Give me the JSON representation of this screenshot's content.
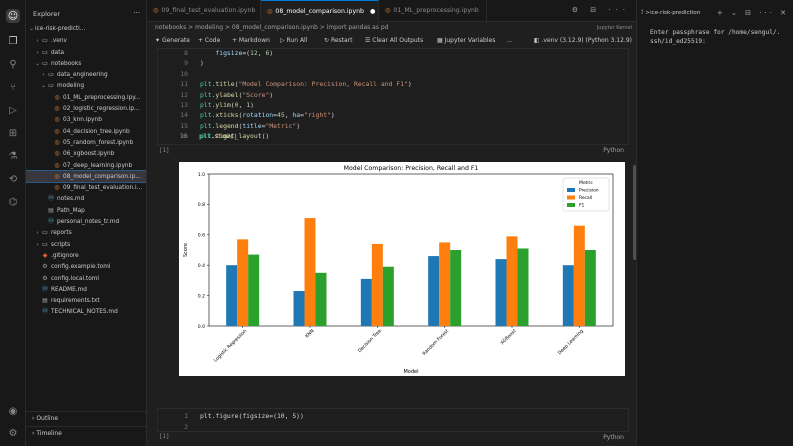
{
  "explorer": {
    "title": "Explorer",
    "root": "ice-risk-predicti...",
    "items": [
      {
        "label": ".venv",
        "type": "folder",
        "depth": 1,
        "collapsed": true
      },
      {
        "label": "data",
        "type": "folder",
        "depth": 1,
        "collapsed": true
      },
      {
        "label": "notebooks",
        "type": "folder",
        "depth": 1,
        "collapsed": false
      },
      {
        "label": "data_engineering",
        "type": "folder",
        "depth": 2,
        "collapsed": true
      },
      {
        "label": "modeling",
        "type": "folder",
        "depth": 2,
        "collapsed": false
      },
      {
        "label": "01_ML_preprocessing.ipy...",
        "type": "notebook",
        "depth": 3
      },
      {
        "label": "02_logistic_regression.ip...",
        "type": "notebook",
        "depth": 3
      },
      {
        "label": "03_knn.ipynb",
        "type": "notebook",
        "depth": 3
      },
      {
        "label": "04_decision_tree.ipynb",
        "type": "notebook",
        "depth": 3
      },
      {
        "label": "05_random_forest.ipynb",
        "type": "notebook",
        "depth": 3
      },
      {
        "label": "06_xgboost.ipynb",
        "type": "notebook",
        "depth": 3
      },
      {
        "label": "07_deep_learning.ipynb",
        "type": "notebook",
        "depth": 3
      },
      {
        "label": "08_model_comparison.ip...",
        "type": "notebook",
        "depth": 3,
        "selected": true
      },
      {
        "label": "09_final_test_evaluation.i...",
        "type": "notebook",
        "depth": 3
      },
      {
        "label": "notes.md",
        "type": "md",
        "depth": 2
      },
      {
        "label": "Path_Map",
        "type": "file",
        "depth": 2
      },
      {
        "label": "personal_notes_tr.md",
        "type": "md",
        "depth": 2
      },
      {
        "label": "reports",
        "type": "folder",
        "depth": 1,
        "collapsed": true
      },
      {
        "label": "scripts",
        "type": "folder",
        "depth": 1,
        "collapsed": true
      },
      {
        "label": ".gitignore",
        "type": "git",
        "depth": 1
      },
      {
        "label": "config.example.toml",
        "type": "toml",
        "depth": 1
      },
      {
        "label": "config.local.toml",
        "type": "toml",
        "depth": 1
      },
      {
        "label": "README.md",
        "type": "md",
        "depth": 1
      },
      {
        "label": "requirements.txt",
        "type": "file",
        "depth": 1
      },
      {
        "label": "TECHNICAL_NOTES.md",
        "type": "md",
        "depth": 1
      }
    ],
    "outline": "Outline",
    "timeline": "Timeline"
  },
  "tabs": [
    {
      "label": "09_final_test_evaluation.ipynb",
      "active": false
    },
    {
      "label": "08_model_comparison.ipynb",
      "active": true
    },
    {
      "label": "01_ML_preprocessing.ipynb",
      "active": false
    }
  ],
  "breadcrumb": "notebooks > modeling > 08_model_comparison.ipynb > import pandas as pd",
  "toolbar": {
    "generate": "Generate",
    "code": "+ Code",
    "markdown": "+ Markdown",
    "run_all": "Run All",
    "restart": "Restart",
    "clear": "Clear All Outputs",
    "variables": "Jupyter Variables",
    "more": "...",
    "kernel": ".venv (3.12.9) (Python 3.12.9)",
    "kernel_tooltip": "Jupyter Kernel"
  },
  "cell1": {
    "lines": [
      "8",
      "9",
      "10",
      "11",
      "12",
      "13",
      "14",
      "15",
      "16"
    ],
    "exec_count": "[1]",
    "language": "Python"
  },
  "cell2": {
    "lines": [
      "1",
      "2"
    ],
    "exec_count": "[1]",
    "language": "Python",
    "code": "plt.figure(figsize=(10, 5))"
  },
  "terminal": {
    "tab": "ℐ >ice-risk-prediction",
    "line1": "Enter passphrase for /home/sengul/.",
    "line2": "ssh/id_ed25519:"
  },
  "chart_data": {
    "type": "bar",
    "title": "Model Comparison: Precision, Recall and F1",
    "xlabel": "Model",
    "ylabel": "Score",
    "ylim": [
      0,
      1
    ],
    "yticks": [
      "0.0",
      "0.2",
      "0.4",
      "0.6",
      "0.8",
      "1.0"
    ],
    "categories": [
      "Logistic Regression",
      "KNN",
      "Decision Tree",
      "Random Forest",
      "XGBoost",
      "Deep Learning"
    ],
    "legend_title": "Metric",
    "legend_position": "top-right",
    "series": [
      {
        "name": "Precision",
        "color": "#1f77b4",
        "values": [
          0.4,
          0.23,
          0.31,
          0.46,
          0.44,
          0.4
        ]
      },
      {
        "name": "Recall",
        "color": "#ff7f0e",
        "values": [
          0.57,
          0.71,
          0.54,
          0.55,
          0.59,
          0.66
        ]
      },
      {
        "name": "F1",
        "color": "#2ca02c",
        "values": [
          0.47,
          0.35,
          0.39,
          0.5,
          0.51,
          0.5
        ]
      }
    ]
  }
}
